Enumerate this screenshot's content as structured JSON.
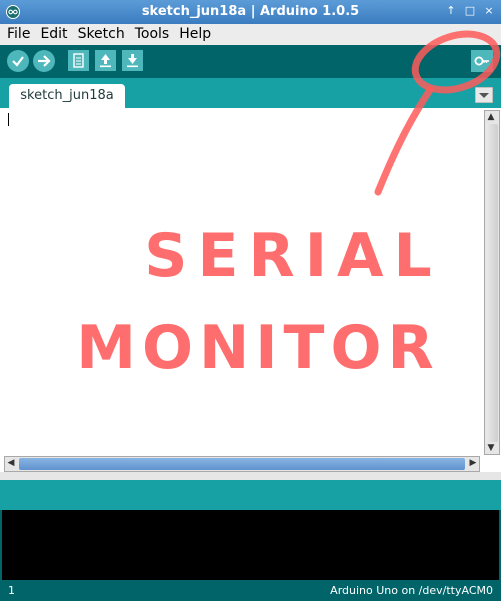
{
  "window": {
    "title": "sketch_jun18a | Arduino 1.0.5",
    "controls": [
      "↑",
      "□",
      "×"
    ]
  },
  "menu": [
    "File",
    "Edit",
    "Sketch",
    "Tools",
    "Help"
  ],
  "toolbar": {
    "buttons": [
      "verify-icon",
      "upload-icon",
      "new-icon",
      "open-icon",
      "save-icon",
      "serial-monitor-icon"
    ]
  },
  "tabs": [
    {
      "label": "sketch_jun18a"
    }
  ],
  "editor": {
    "content": ""
  },
  "annotation": {
    "line1": "SERIAL",
    "line2": "MONITOR",
    "color": "#ff5a5a"
  },
  "status": {
    "line": "1",
    "board": "Arduino Uno on /dev/ttyACM0"
  },
  "colors": {
    "toolbar": "#006468",
    "tab_bar": "#17a1a5",
    "button": "#4db7bb",
    "titlebar": "#3b7cc0"
  }
}
